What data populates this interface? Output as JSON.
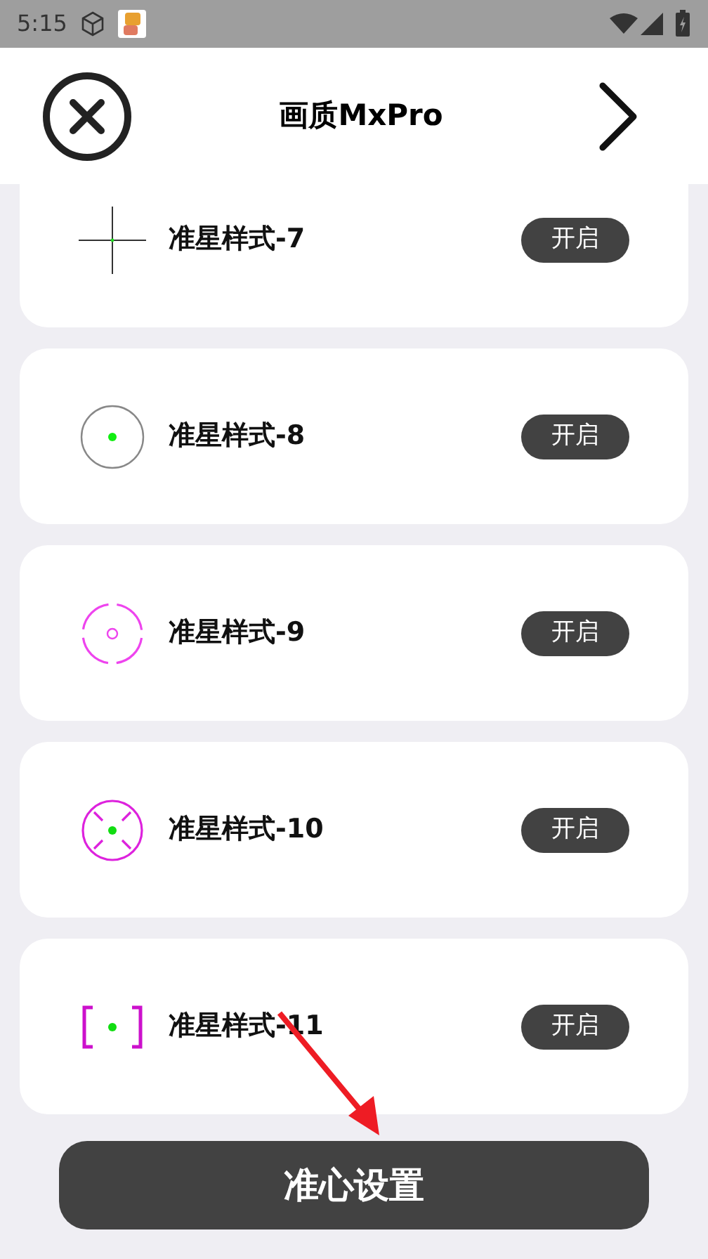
{
  "status_bar": {
    "time": "5:15"
  },
  "header": {
    "title": "画质MxPro"
  },
  "crosshairs": [
    {
      "kind": "cross",
      "label": "准星样式-7",
      "toggle": "开启"
    },
    {
      "kind": "ring",
      "label": "准星样式-8",
      "toggle": "开启"
    },
    {
      "kind": "dashed-ring",
      "label": "准星样式-9",
      "toggle": "开启"
    },
    {
      "kind": "circle-ticks",
      "label": "准星样式-10",
      "toggle": "开启"
    },
    {
      "kind": "brackets",
      "label": "准星样式-11",
      "toggle": "开启"
    }
  ],
  "footer_button": "准心设置"
}
